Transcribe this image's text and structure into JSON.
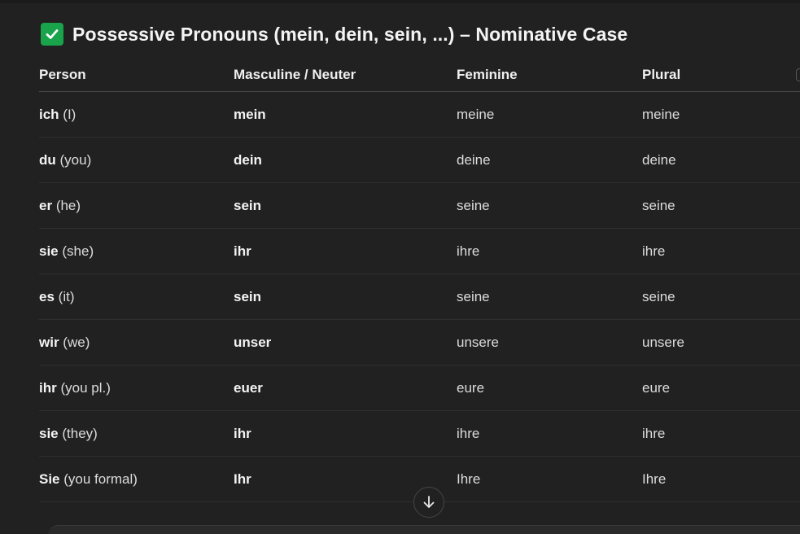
{
  "heading": {
    "icon": "check-mark-icon",
    "title": "Possessive Pronouns (mein, dein, sein, ...) – Nominative Case",
    "icon_color": "#19a34a"
  },
  "table": {
    "headers": [
      "Person",
      "Masculine / Neuter",
      "Feminine",
      "Plural"
    ],
    "rows": [
      {
        "pronoun": "ich",
        "gloss": "(I)",
        "masc": "mein",
        "fem": "meine",
        "plural": "meine"
      },
      {
        "pronoun": "du",
        "gloss": "(you)",
        "masc": "dein",
        "fem": "deine",
        "plural": "deine"
      },
      {
        "pronoun": "er",
        "gloss": "(he)",
        "masc": "sein",
        "fem": "seine",
        "plural": "seine"
      },
      {
        "pronoun": "sie",
        "gloss": "(she)",
        "masc": "ihr",
        "fem": "ihre",
        "plural": "ihre"
      },
      {
        "pronoun": "es",
        "gloss": "(it)",
        "masc": "sein",
        "fem": "seine",
        "plural": "seine"
      },
      {
        "pronoun": "wir",
        "gloss": "(we)",
        "masc": "unser",
        "fem": "unsere",
        "plural": "unsere"
      },
      {
        "pronoun": "ihr",
        "gloss": "(you pl.)",
        "masc": "euer",
        "fem": "eure",
        "plural": "eure"
      },
      {
        "pronoun": "sie",
        "gloss": "(they)",
        "masc": "ihr",
        "fem": "ihre",
        "plural": "ihre"
      },
      {
        "pronoun": "Sie",
        "gloss": "(you formal)",
        "masc": "Ihr",
        "fem": "Ihre",
        "plural": "Ihre"
      }
    ]
  },
  "controls": {
    "scroll_down_icon": "arrow-down-icon"
  },
  "colors": {
    "background": "#212121",
    "text": "#ececec"
  }
}
